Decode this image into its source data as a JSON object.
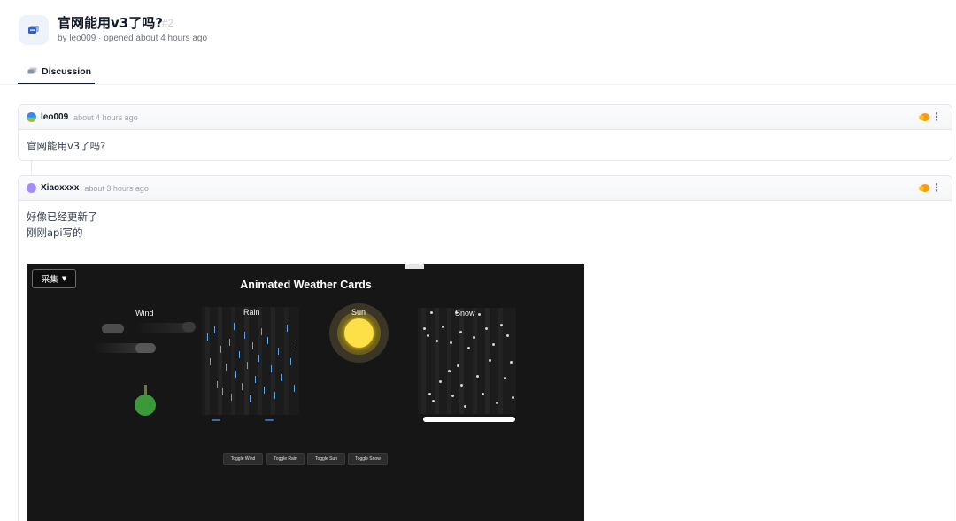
{
  "header": {
    "title": "官网能用v3了吗?",
    "number": "#2",
    "meta": "by leo009 · opened about 4 hours ago",
    "tab_label": "Discussion",
    "icon": "chat-bubbles-icon"
  },
  "posts": [
    {
      "author": "leo009",
      "time": "about 4 hours ago",
      "lines": [
        "官网能用v3了吗?"
      ]
    },
    {
      "author": "Xiaoxxxx",
      "time": "about 3 hours ago",
      "lines": [
        "好像已经更新了",
        "刚刚api写的"
      ]
    }
  ],
  "embed": {
    "dropdown": "采集",
    "title": "Animated Weather Cards",
    "cards": [
      "Wind",
      "Rain",
      "Sun",
      "Snow"
    ],
    "buttons": [
      "Toggle Wind",
      "Toggle Rain",
      "Toggle Sun",
      "Toggle Snow"
    ]
  },
  "colors": {
    "reaction": "#f59e0b",
    "sun": "#fde047",
    "tree": "#3a9a3a",
    "rain": "#5aa6e8",
    "background": "#161616"
  }
}
